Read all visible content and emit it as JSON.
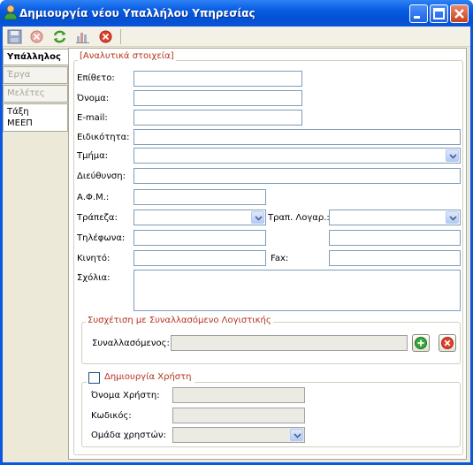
{
  "window": {
    "title": "Δημιουργία νέου Υπαλλήλου Υπηρεσίας",
    "user_icon": "user-icon",
    "controls": [
      "minimize-icon",
      "maximize-icon",
      "close-icon"
    ]
  },
  "toolbar": {
    "icons": [
      "save-icon",
      "delete-icon",
      "refresh-icon",
      "report-icon",
      "cancel-icon"
    ]
  },
  "tabs": [
    {
      "label": "Υπάλληλος",
      "state": "active"
    },
    {
      "label": "Έργα",
      "state": "disabled"
    },
    {
      "label": "Μελέτες",
      "state": "disabled"
    },
    {
      "label_line1": "Τάξη",
      "label_line2": "ΜΕΕΠ",
      "state": "enabled"
    }
  ],
  "details": {
    "legend": "[Αναλυτικά στοιχεία]",
    "surname_label": "Επίθετο:",
    "surname_value": "",
    "name_label": "Όνομα:",
    "name_value": "",
    "email_label": "E-mail:",
    "email_value": "",
    "specialty_label": "Ειδικότητα:",
    "specialty_value": "",
    "department_label": "Τμήμα:",
    "department_value": "",
    "address_label": "Διεύθυνση:",
    "address_value": "",
    "afm_label": "Α.Φ.Μ.:",
    "afm_value": "",
    "bank_label": "Τράπεζα:",
    "bank_value": "",
    "bank_account_label": "Τραπ. Λογαρ.:",
    "bank_account_value": "",
    "phones_label": "Τηλέφωνα:",
    "phones_value": "",
    "phones_value2": "",
    "mobile_label": "Κινητό:",
    "mobile_value": "",
    "fax_label": "Fax:",
    "fax_value": "",
    "comments_label": "Σχόλια:",
    "comments_value": ""
  },
  "accounting": {
    "legend": "Συσχέτιση με Συναλλασόμενο Λογιστικής",
    "counterparty_label": "Συναλλασόμενος:",
    "counterparty_value": "",
    "add_icon": "add-icon",
    "remove_icon": "remove-icon"
  },
  "user_creation": {
    "checkbox_label": "Δημιουργία Χρήστη",
    "checked": false,
    "username_label": "Όνομα Χρήστη:",
    "username_value": "",
    "password_label": "Κωδικός:",
    "password_value": "",
    "group_label": "Ομάδα χρηστών:",
    "group_value": ""
  },
  "colors": {
    "titlebar": "#0a5fe4",
    "legend_text": "#b4321c",
    "panel_bg": "#ffffff",
    "chrome_bg": "#ece9d8"
  }
}
